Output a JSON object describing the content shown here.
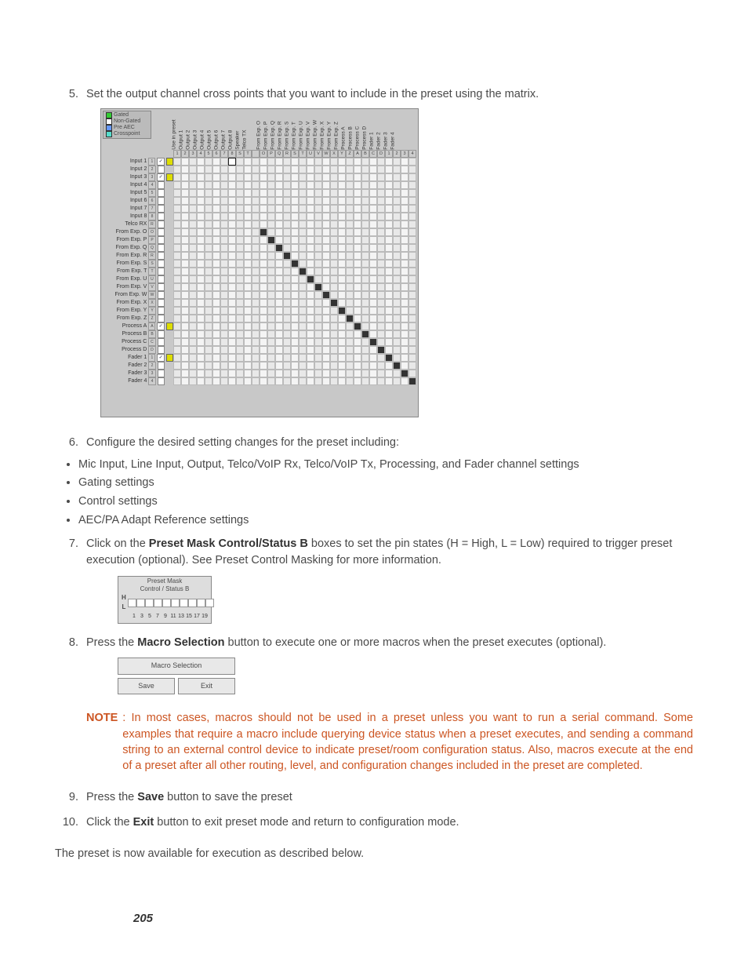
{
  "steps": {
    "s5": {
      "num": "5.",
      "text": "Set the output channel cross points that you want to include in the preset using the matrix."
    },
    "s6": {
      "num": "6.",
      "text": "Configure the desired setting changes for the preset including:",
      "bullets": [
        "Mic Input, Line Input, Output, Telco/VoIP Rx, Telco/VoIP Tx, Processing, and Fader channel settings",
        "Gating settings",
        "Control settings",
        "AEC/PA Adapt Reference settings"
      ]
    },
    "s7": {
      "num": "7.",
      "pre": "Click on the ",
      "bold": "Preset Mask Control/Status B",
      "post": " boxes to set the pin states (H = High, L = Low) required to trigger preset execution (optional). See Preset Control Masking for more information."
    },
    "s8": {
      "num": "8.",
      "pre": "Press the ",
      "bold": "Macro Selection",
      "post": " button to execute one or more macros when the preset executes (optional)."
    },
    "s9": {
      "num": "9.",
      "pre": "Press the ",
      "bold": "Save",
      "post": " button to save the preset"
    },
    "s10": {
      "num": "10.",
      "pre": "Click the ",
      "bold": "Exit",
      "post": " button to exit preset mode and return to configuration mode."
    }
  },
  "note": {
    "label": "NOTE",
    "text": ": In most cases, macros should not be used in a preset unless you want to run a serial command. Some examples that require a macro include querying device status when a preset executes, and sending a command string to an external control device to indicate preset/room configuration status. Also, macros execute at the end of a preset after all other routing, level, and configuration changes included in the preset are completed."
  },
  "closing": "The preset is now available for execution as described below.",
  "page_number": "205",
  "matrix": {
    "legend": [
      {
        "color": "#33cc33",
        "label": "Gated"
      },
      {
        "color": "#ffffff",
        "label": "Non-Gated"
      },
      {
        "color": "#6699ff",
        "label": "Pre AEC"
      },
      {
        "color": "#55ddcc",
        "label": "Crosspoint"
      }
    ],
    "col_headers": [
      "Use in preset",
      "Output 1",
      "Output 2",
      "Output 3",
      "Output 4",
      "Output 5",
      "Output 6",
      "Output 7",
      "Output 8",
      "Speaker",
      "Telco TX",
      "",
      "From Exp. O",
      "From Exp. P",
      "From Exp. Q",
      "From Exp. R",
      "From Exp. S",
      "From Exp. T",
      "From Exp. U",
      "From Exp. V",
      "From Exp. W",
      "From Exp. X",
      "From Exp. Y",
      "From Exp. Z",
      "Process A",
      "Process B",
      "Process C",
      "Process D",
      "Fader 1",
      "Fader 2",
      "Fader 3",
      "Fader 4"
    ],
    "col_idx": [
      "1",
      "2",
      "3",
      "4",
      "5",
      "6",
      "7",
      "8",
      "S",
      "T",
      "",
      "O",
      "P",
      "Q",
      "R",
      "S",
      "T",
      "U",
      "V",
      "W",
      "X",
      "Y",
      "Z",
      "A",
      "B",
      "C",
      "D",
      "1",
      "2",
      "3",
      "4"
    ],
    "rows": [
      {
        "label": "Input 1",
        "idx": "1",
        "chk": true,
        "yel": true,
        "sel": 7,
        "diag": -1
      },
      {
        "label": "Input 2",
        "idx": "2",
        "chk": false,
        "yel": false,
        "diag": -1
      },
      {
        "label": "Input 3",
        "idx": "3",
        "chk": true,
        "yel": true,
        "diag": -1
      },
      {
        "label": "Input 4",
        "idx": "4",
        "chk": false,
        "yel": false,
        "diag": -1
      },
      {
        "label": "Input 5",
        "idx": "5",
        "chk": false,
        "yel": false,
        "diag": -1
      },
      {
        "label": "Input 6",
        "idx": "6",
        "chk": false,
        "yel": false,
        "diag": -1
      },
      {
        "label": "Input 7",
        "idx": "7",
        "chk": false,
        "yel": false,
        "diag": -1
      },
      {
        "label": "Input 8",
        "idx": "8",
        "chk": false,
        "yel": false,
        "diag": -1
      },
      {
        "label": "Telco RX",
        "idx": "R",
        "chk": false,
        "yel": false,
        "diag": -1
      },
      {
        "label": "From Exp. O",
        "idx": "O",
        "chk": false,
        "yel": false,
        "diag": 11
      },
      {
        "label": "From Exp. P",
        "idx": "P",
        "chk": false,
        "yel": false,
        "diag": 12
      },
      {
        "label": "From Exp. Q",
        "idx": "Q",
        "chk": false,
        "yel": false,
        "diag": 13
      },
      {
        "label": "From Exp. R",
        "idx": "R",
        "chk": false,
        "yel": false,
        "diag": 14
      },
      {
        "label": "From Exp. S",
        "idx": "S",
        "chk": false,
        "yel": false,
        "diag": 15
      },
      {
        "label": "From Exp. T",
        "idx": "T",
        "chk": false,
        "yel": false,
        "diag": 16
      },
      {
        "label": "From Exp. U",
        "idx": "U",
        "chk": false,
        "yel": false,
        "diag": 17
      },
      {
        "label": "From Exp. V",
        "idx": "V",
        "chk": false,
        "yel": false,
        "diag": 18
      },
      {
        "label": "From Exp. W",
        "idx": "W",
        "chk": false,
        "yel": false,
        "diag": 19
      },
      {
        "label": "From Exp. X",
        "idx": "X",
        "chk": false,
        "yel": false,
        "diag": 20
      },
      {
        "label": "From Exp. Y",
        "idx": "Y",
        "chk": false,
        "yel": false,
        "diag": 21
      },
      {
        "label": "From Exp. Z",
        "idx": "Z",
        "chk": false,
        "yel": false,
        "diag": 22
      },
      {
        "label": "Process A",
        "idx": "A",
        "chk": true,
        "yel": true,
        "diag": 23
      },
      {
        "label": "Process B",
        "idx": "B",
        "chk": false,
        "yel": false,
        "diag": 24
      },
      {
        "label": "Process C",
        "idx": "C",
        "chk": false,
        "yel": false,
        "diag": 25
      },
      {
        "label": "Process D",
        "idx": "D",
        "chk": false,
        "yel": false,
        "diag": 26
      },
      {
        "label": "Fader 1",
        "idx": "1",
        "chk": true,
        "yel": true,
        "diag": 27
      },
      {
        "label": "Fader 2",
        "idx": "2",
        "chk": false,
        "yel": false,
        "diag": 28
      },
      {
        "label": "Fader 3",
        "idx": "3",
        "chk": false,
        "yel": false,
        "diag": 29
      },
      {
        "label": "Fader 4",
        "idx": "4",
        "chk": false,
        "yel": false,
        "diag": 30
      }
    ],
    "n_cols": 31
  },
  "mask": {
    "title1": "Preset Mask",
    "title2": "Control / Status B",
    "hl": "H L",
    "nums": [
      "1",
      "3",
      "5",
      "7",
      "9",
      "11",
      "13",
      "15",
      "17",
      "19"
    ]
  },
  "macro": {
    "sel": "Macro Selection",
    "save": "Save",
    "exit": "Exit"
  }
}
